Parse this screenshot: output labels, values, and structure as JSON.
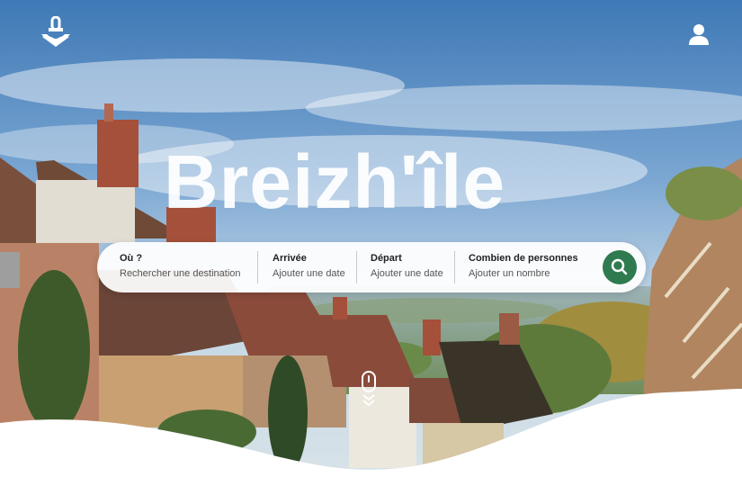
{
  "brand": {
    "name": "Breizh'île"
  },
  "header": {
    "logo_icon": "anchor-icon",
    "account_icon": "user-icon"
  },
  "search": {
    "where": {
      "label": "Où ?",
      "placeholder": "Rechercher une destination"
    },
    "arrival": {
      "label": "Arrivée",
      "placeholder": "Ajouter une date"
    },
    "departure": {
      "label": "Départ",
      "placeholder": "Ajouter une date"
    },
    "guests": {
      "label": "Combien de personnes",
      "placeholder": "Ajouter un nombre"
    },
    "button_icon": "search-icon"
  },
  "scroll_icon": "scroll-down-icon",
  "colors": {
    "accent": "#2f7a4f",
    "wave": "#ffffff"
  }
}
